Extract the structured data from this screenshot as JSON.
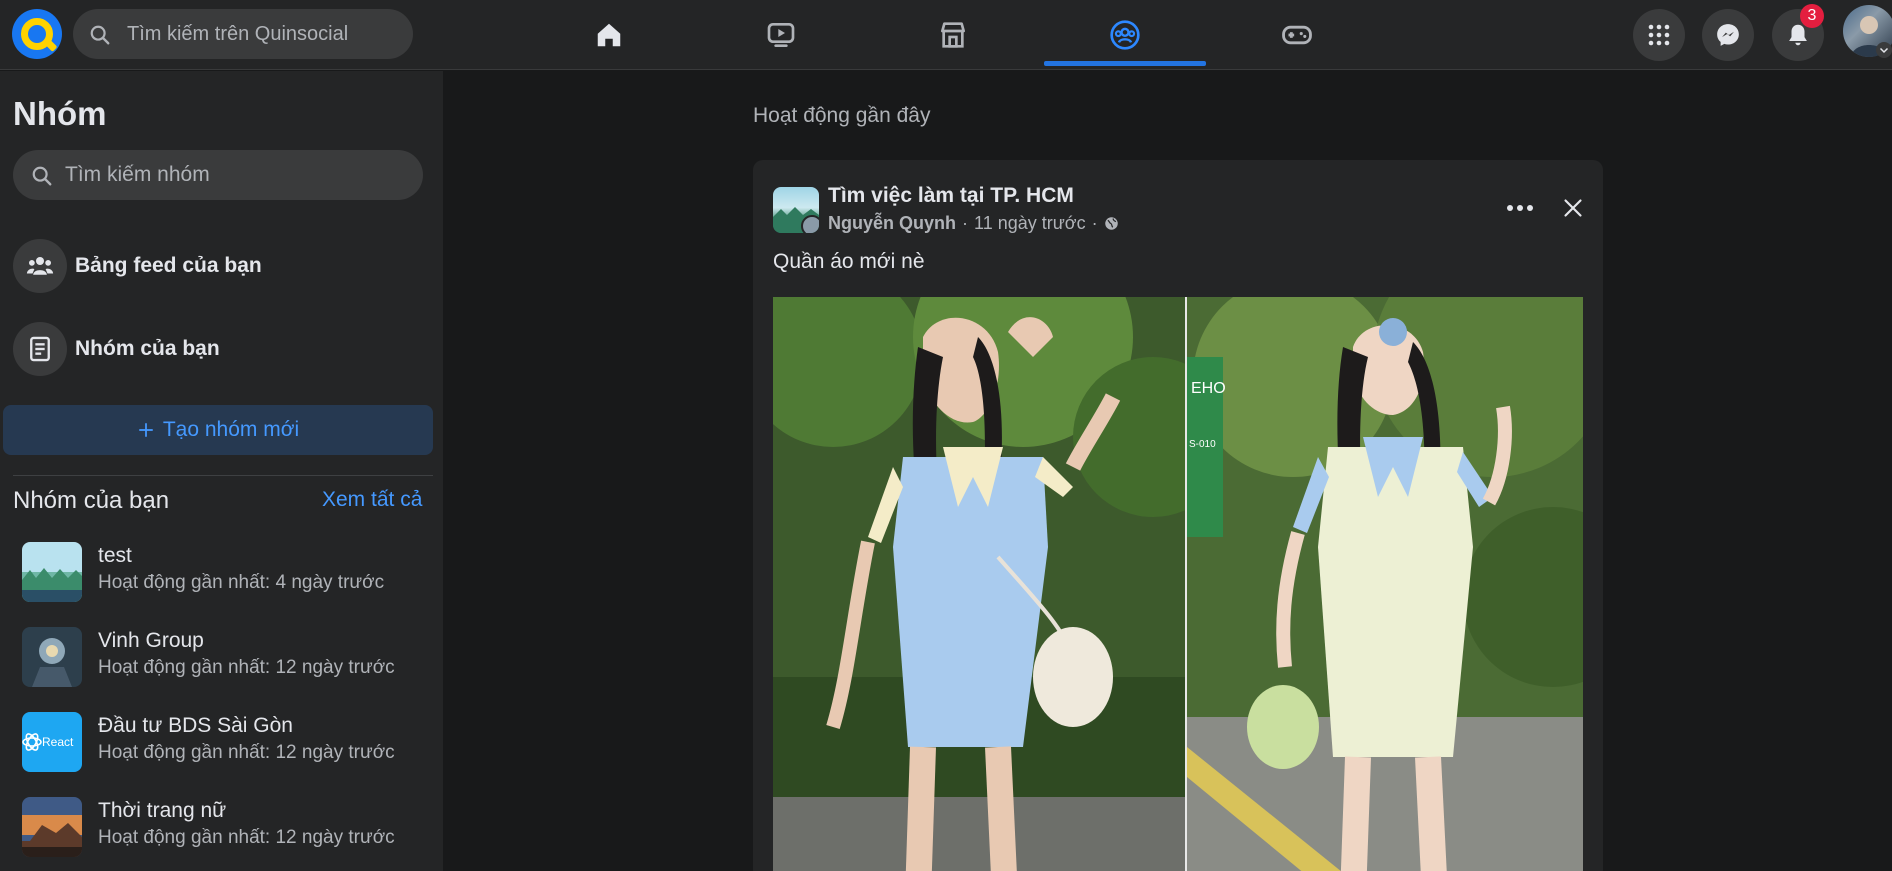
{
  "topbar": {
    "search_placeholder": "Tìm kiếm trên Quinsocial",
    "notifications_count": "3"
  },
  "sidebar": {
    "title": "Nhóm",
    "search_placeholder": "Tìm kiếm nhóm",
    "items": [
      {
        "label": "Bảng feed của bạn",
        "icon": "people-icon"
      },
      {
        "label": "Nhóm của bạn",
        "icon": "document-icon"
      }
    ],
    "create_label": "Tạo nhóm mới",
    "your_groups_heading": "Nhóm của bạn",
    "see_all_label": "Xem tất cả",
    "groups": [
      {
        "name": "test",
        "activity": "Hoạt động gần nhất: 4 ngày trước"
      },
      {
        "name": "Vinh Group",
        "activity": "Hoạt động gần nhất: 12 ngày trước"
      },
      {
        "name": "Đầu tư BDS Sài Gòn",
        "activity": "Hoạt động gần nhất: 12 ngày trước",
        "thumb_text": "React"
      },
      {
        "name": "Thời trang nữ",
        "activity": "Hoạt động gần nhất: 12 ngày trước"
      }
    ]
  },
  "main": {
    "recent_heading": "Hoạt động gần đây",
    "post": {
      "group_name": "Tìm việc làm tại TP. HCM",
      "author": "Nguyễn Quynh",
      "time": "11 ngày trước",
      "separator": "·",
      "content": "Quần áo mới nè",
      "photo_sign": "EHO",
      "photo_sign_sub": "S-010"
    }
  },
  "colors": {
    "accent": "#2374e1",
    "link": "#4599ff",
    "badge": "#e41e3f",
    "surface": "#242526",
    "background": "#18191a"
  }
}
